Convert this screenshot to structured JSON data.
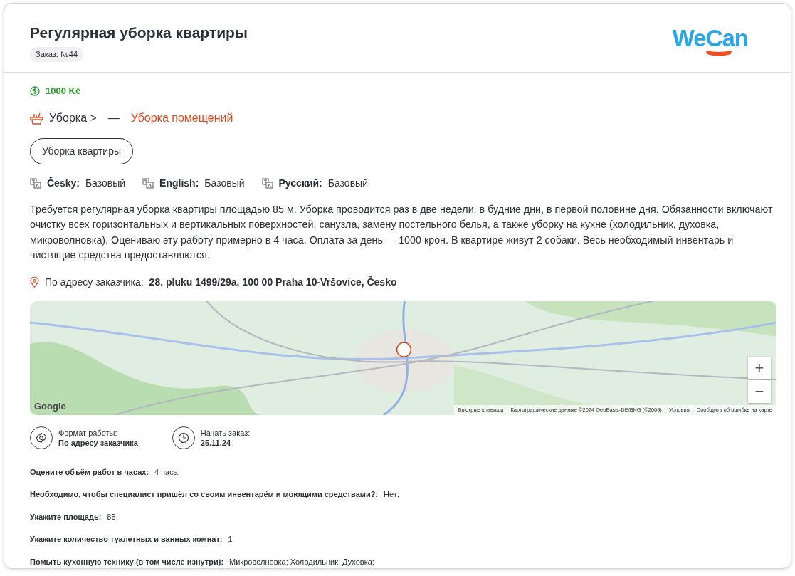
{
  "header": {
    "title": "Регулярная уборка квартиры",
    "order_badge": "Заказ: №44",
    "logo": "WeCan"
  },
  "price": "1000 Kč",
  "category": {
    "parent": "Уборка >",
    "separator": "—",
    "child": "Уборка помещений"
  },
  "tag_button": "Уборка квартиры",
  "languages": [
    {
      "name": "Česky:",
      "level": "Базовый"
    },
    {
      "name": "English:",
      "level": "Базовый"
    },
    {
      "name": "Русский:",
      "level": "Базовый"
    }
  ],
  "description": "Требуется регулярная уборка квартиры площадью 85 м. Уборка проводится раз в две недели, в будние дни, в первой половине дня. Обязанности включают очистку всех горизонтальных и вертикальных поверхностей, санузла, замену постельного белья, а также уборку на кухне (холодильник, духовка, микроволновка). Оцениваю эту работу примерно в 4 часа. Оплата за день — 1000 крон. В квартире живут 2 собаки. Весь необходимый инвентарь и чистящие средства предоставляются.",
  "address": {
    "label": "По адресу заказчика:",
    "value": "28. pluku 1499/29a, 100 00 Praha 10-Vršovice, Česko"
  },
  "map": {
    "zoom_in": "+",
    "zoom_out": "−",
    "logo": "Google",
    "attribution": [
      "Быстрые клавиши",
      "Картографические данные ©2024 GeoBasis-DE/BKG (©2009)",
      "Условия",
      "Сообщить об ошибке на карте"
    ]
  },
  "info": [
    {
      "kind": "format",
      "label": "Формат работы:",
      "value": "По адресу заказчика"
    },
    {
      "kind": "start",
      "label": "Начать заказ:",
      "value": "25.11.24"
    }
  ],
  "answers": [
    {
      "question": "Оцените объём работ в часах:",
      "answer": "4 часа;"
    },
    {
      "question": "Необходимо, чтобы специалист пришёл со своим инвентарём и моющими средствами?:",
      "answer": "Нет;"
    },
    {
      "question": "Укажите площадь:",
      "answer": "85"
    },
    {
      "question": "Укажите количество туалетных и ванных комнат:",
      "answer": "1"
    },
    {
      "question": "Помыть кухонную технику (в том числе изнутри):",
      "answer": "Микроволновка; Холодильник; Духовка;"
    }
  ]
}
